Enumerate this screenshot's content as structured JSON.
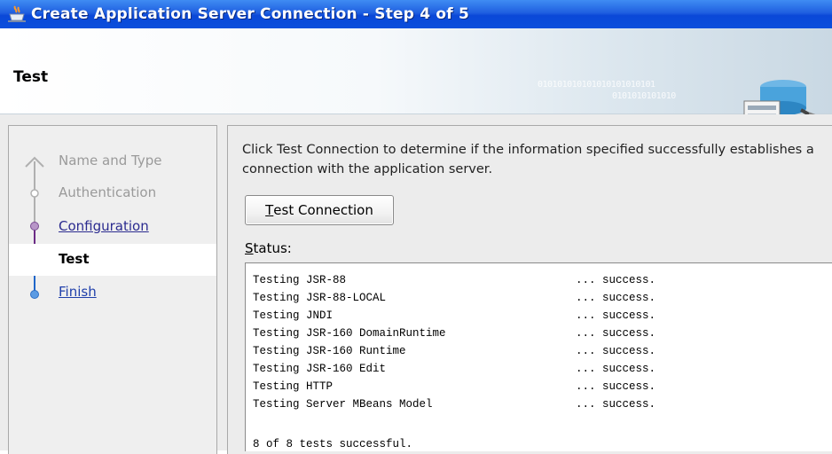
{
  "window": {
    "title": "Create Application Server Connection - Step 4 of 5"
  },
  "header": {
    "page_title": "Test",
    "binary_line1": "010101010101010101010101",
    "binary_line2": "0101010101010"
  },
  "steps": [
    {
      "label": "Name and Type",
      "state": "done"
    },
    {
      "label": "Authentication",
      "state": "done"
    },
    {
      "label": "Configuration",
      "state": "link"
    },
    {
      "label": "Test",
      "state": "current"
    },
    {
      "label": "Finish",
      "state": "link"
    }
  ],
  "main": {
    "intro": "Click Test Connection to determine if the information specified successfully establishes a connection with the application server.",
    "test_button": {
      "label_mnemonic": "T",
      "label_rest": "est Connection"
    },
    "status_label": {
      "mnemonic": "S",
      "rest": "tatus:"
    },
    "results": [
      {
        "name": "Testing JSR-88",
        "result": "... success."
      },
      {
        "name": "Testing JSR-88-LOCAL",
        "result": "... success."
      },
      {
        "name": "Testing JNDI",
        "result": "... success."
      },
      {
        "name": "Testing JSR-160 DomainRuntime",
        "result": "... success."
      },
      {
        "name": "Testing JSR-160 Runtime",
        "result": "... success."
      },
      {
        "name": "Testing JSR-160 Edit",
        "result": "... success."
      },
      {
        "name": "Testing HTTP",
        "result": "... success."
      },
      {
        "name": "Testing Server MBeans Model",
        "result": "... success."
      }
    ],
    "summary": "8 of 8 tests successful."
  },
  "colors": {
    "titlebar": "#0a48d8",
    "current_step": "#5b1a73",
    "link": "#2b2b8f"
  },
  "icons": {
    "title": "coffee-cup-icon",
    "header_art": "server-database-icon"
  }
}
